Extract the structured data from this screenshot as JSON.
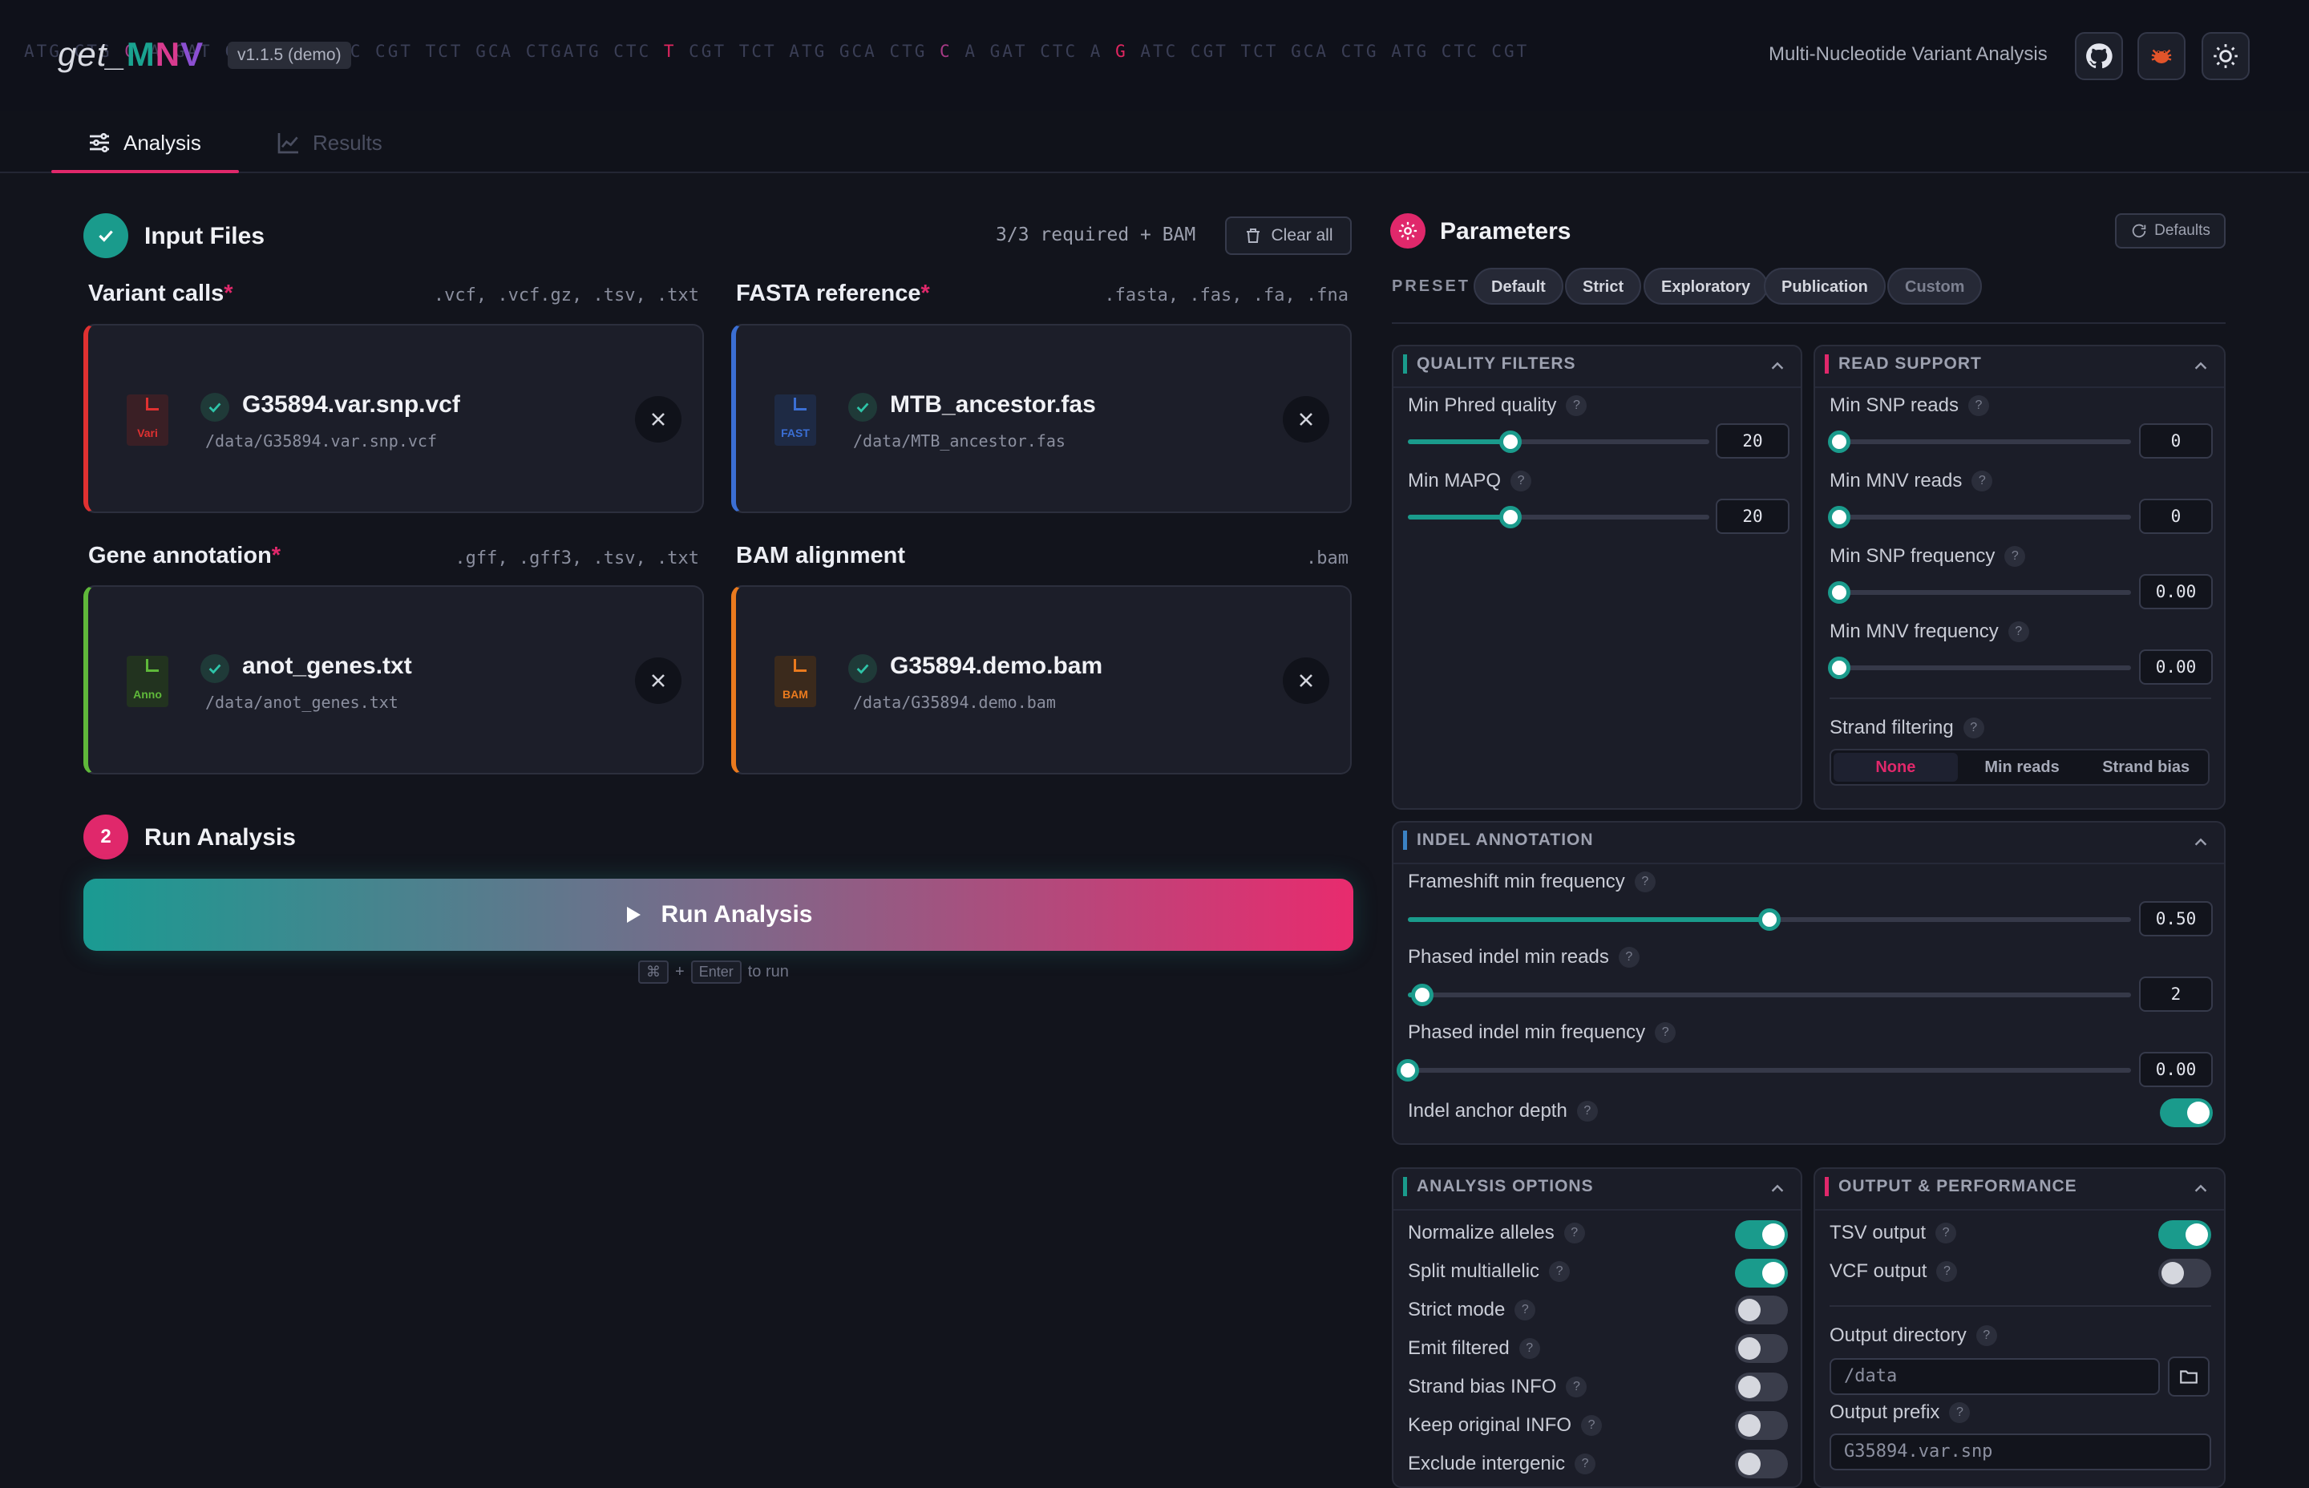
{
  "header": {
    "logo_prefix": "get_",
    "logo_m": "M",
    "logo_n": "N",
    "logo_v": "V",
    "version": "v1.1.5 (demo)",
    "tagline": "Multi-Nucleotide Variant Analysis",
    "icons": [
      "github-icon",
      "bug-icon",
      "sun-icon"
    ]
  },
  "tabs": [
    {
      "label": "Analysis",
      "icon": "sliders-icon",
      "active": true
    },
    {
      "label": "Results",
      "icon": "chart-line-icon",
      "active": false
    }
  ],
  "input_files": {
    "title": "Input Files",
    "required_status": "3/3 required + BAM",
    "clear_label": "Clear all",
    "files": [
      {
        "label": "Variant calls",
        "required": true,
        "extensions": ".vcf, .vcf.gz, .tsv, .txt",
        "icon_text": "Vari",
        "filename": "G35894.var.snp.vcf",
        "path": "/data/G35894.var.snp.vcf",
        "color": "#e03131"
      },
      {
        "label": "FASTA reference",
        "required": true,
        "extensions": ".fasta, .fas, .fa, .fna",
        "icon_text": "FAST",
        "filename": "MTB_ancestor.fas",
        "path": "/data/MTB_ancestor.fas",
        "color": "#3b6fd4"
      },
      {
        "label": "Gene annotation",
        "required": true,
        "extensions": ".gff, .gff3, .tsv, .txt",
        "icon_text": "Anno",
        "filename": "anot_genes.txt",
        "path": "/data/anot_genes.txt",
        "color": "#5fb83a"
      },
      {
        "label": "BAM alignment",
        "required": false,
        "extensions": ".bam",
        "icon_text": "BAM",
        "filename": "G35894.demo.bam",
        "path": "/data/G35894.demo.bam",
        "color": "#ea7a1e"
      }
    ]
  },
  "run": {
    "step": "2",
    "title": "Run Analysis",
    "button_label": "Run Analysis",
    "hint_key1": "⌘",
    "hint_plus": "+",
    "hint_key2": "Enter",
    "hint_text": "to run"
  },
  "parameters": {
    "title": "Parameters",
    "defaults_label": "Defaults",
    "preset_label": "PRESET",
    "presets": [
      "Default",
      "Strict",
      "Exploratory",
      "Publication",
      "Custom"
    ],
    "quality_filters": {
      "title": "QUALITY FILTERS",
      "min_phred": {
        "label": "Min Phred quality",
        "value": "20",
        "fraction": 0.34
      },
      "min_mapq": {
        "label": "Min MAPQ",
        "value": "20",
        "fraction": 0.34
      }
    },
    "read_support": {
      "title": "READ SUPPORT",
      "min_snp_reads": {
        "label": "Min SNP reads",
        "value": "0",
        "fraction": 0.0
      },
      "min_mnv_reads": {
        "label": "Min MNV reads",
        "value": "0",
        "fraction": 0.0
      },
      "min_snp_freq": {
        "label": "Min SNP frequency",
        "value": "0.00",
        "fraction": 0.0
      },
      "min_mnv_freq": {
        "label": "Min MNV frequency",
        "value": "0.00",
        "fraction": 0.0
      },
      "strand_filtering": {
        "label": "Strand filtering",
        "options": [
          "None",
          "Min reads",
          "Strand bias"
        ],
        "selected": "None"
      }
    },
    "indel_annotation": {
      "title": "INDEL ANNOTATION",
      "frameshift": {
        "label": "Frameshift min frequency",
        "value": "0.50",
        "fraction": 0.5
      },
      "phased_reads": {
        "label": "Phased indel min reads",
        "value": "2",
        "fraction": 0.02
      },
      "phased_freq": {
        "label": "Phased indel min frequency",
        "value": "0.00",
        "fraction": 0.0
      },
      "anchor_depth": {
        "label": "Indel anchor depth",
        "on": true
      }
    },
    "analysis_options": {
      "title": "ANALYSIS OPTIONS",
      "items": [
        {
          "label": "Normalize alleles",
          "on": true
        },
        {
          "label": "Split multiallelic",
          "on": true
        },
        {
          "label": "Strict mode",
          "on": false
        },
        {
          "label": "Emit filtered",
          "on": false
        },
        {
          "label": "Strand bias INFO",
          "on": false
        },
        {
          "label": "Keep original INFO",
          "on": false
        },
        {
          "label": "Exclude intergenic",
          "on": false
        }
      ]
    },
    "output": {
      "title": "OUTPUT & PERFORMANCE",
      "tsv": {
        "label": "TSV output",
        "on": true
      },
      "vcf": {
        "label": "VCF output",
        "on": false
      },
      "dir_label": "Output directory",
      "dir_placeholder": "/data",
      "prefix_label": "Output prefix",
      "prefix_placeholder": "G35894.var.snp"
    }
  },
  "colors": {
    "teal": "#1a9b8c",
    "pink": "#e0286b",
    "blue": "#3b82c4"
  }
}
